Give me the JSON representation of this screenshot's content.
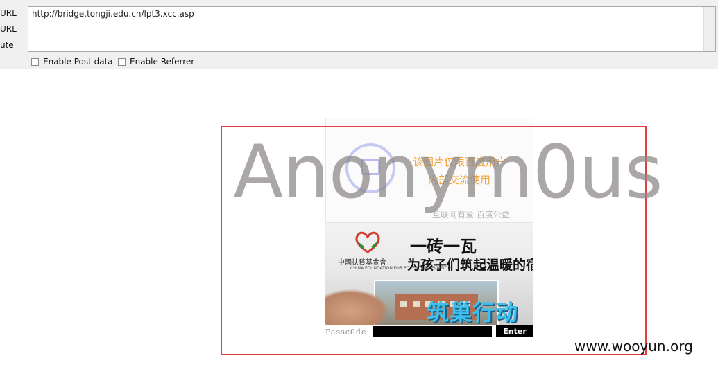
{
  "toolbar": {
    "side_labels": [
      "URL",
      "URL",
      "ute"
    ],
    "url_value": "http://bridge.tongji.edu.cn/lpt3.xcc.asp",
    "post_label": "Enable Post data",
    "referrer_label": "Enable Referrer"
  },
  "login_page": {
    "placeholder_line1": "该图片仅限百度用户",
    "placeholder_line2": "内部交流使用",
    "placeholder_footer": "互联网有爱 百度公益",
    "banner_org_name": "中國扶貧基金會",
    "banner_org_en": "CHINA FOUNDATION FOR POVERTY ALLEVIATION",
    "banner_slogan1": "一砖一瓦",
    "banner_slogan2": "为孩子们筑起温暖的宿舍",
    "banner_action": "筑巢行动",
    "pass_label": "Passc0de:",
    "enter_label": "Enter"
  },
  "overlay": {
    "anon_text": "Anonym0us",
    "watermark": "www.wooyun.org"
  },
  "colors": {
    "frame": "#e53c3c",
    "placeholder_text": "#f0a33a",
    "action_text": "#3fc1ef"
  }
}
